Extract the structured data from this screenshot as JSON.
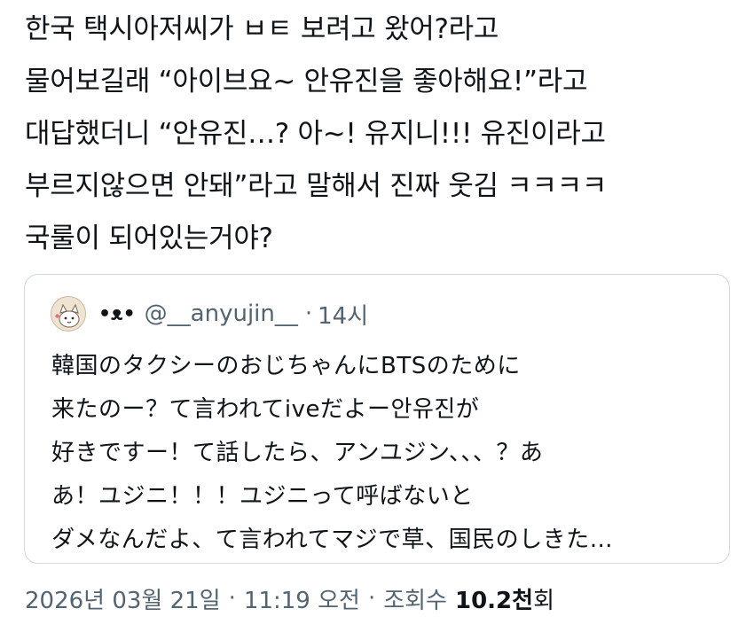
{
  "tweet": {
    "lines": [
      "한국 택시아저씨가 ㅂㅌ 보려고 왔어?라고",
      "물어보길래 “아이브요~ 안유진을 좋아해요!”라고",
      "대답했더니 “안유진…? 아~! 유지니!!! 유진이라고",
      "부르지않으면 안돼”라고 말해서 진짜 웃김 ㅋㅋㅋㅋ",
      "국룰이 되어있는거야?"
    ]
  },
  "quote": {
    "display_name": "•ᴥ•",
    "handle": "@__anyujin__",
    "separator": "·",
    "time": "14시",
    "lines": [
      "韓国のタクシーのおじちゃんにBTSのために",
      "来たのー？て言われてiveだよー안유진が",
      "好きですー！て話したら、アンユジン、、、？あ",
      "あ！ユジニ！！！ユジニって呼ばないと",
      "ダメなんだよ、て言われてマジで草、国民のしきた…"
    ]
  },
  "meta": {
    "date": "2026년 03월 21일",
    "sep1": "·",
    "time": "11:19 오전",
    "sep2": "·",
    "views_label": "조회수",
    "views_count": "10.2천",
    "views_unit": "회"
  },
  "colors": {
    "text_primary": "#0f1419",
    "text_secondary": "#536471",
    "border": "#cfd9de"
  }
}
